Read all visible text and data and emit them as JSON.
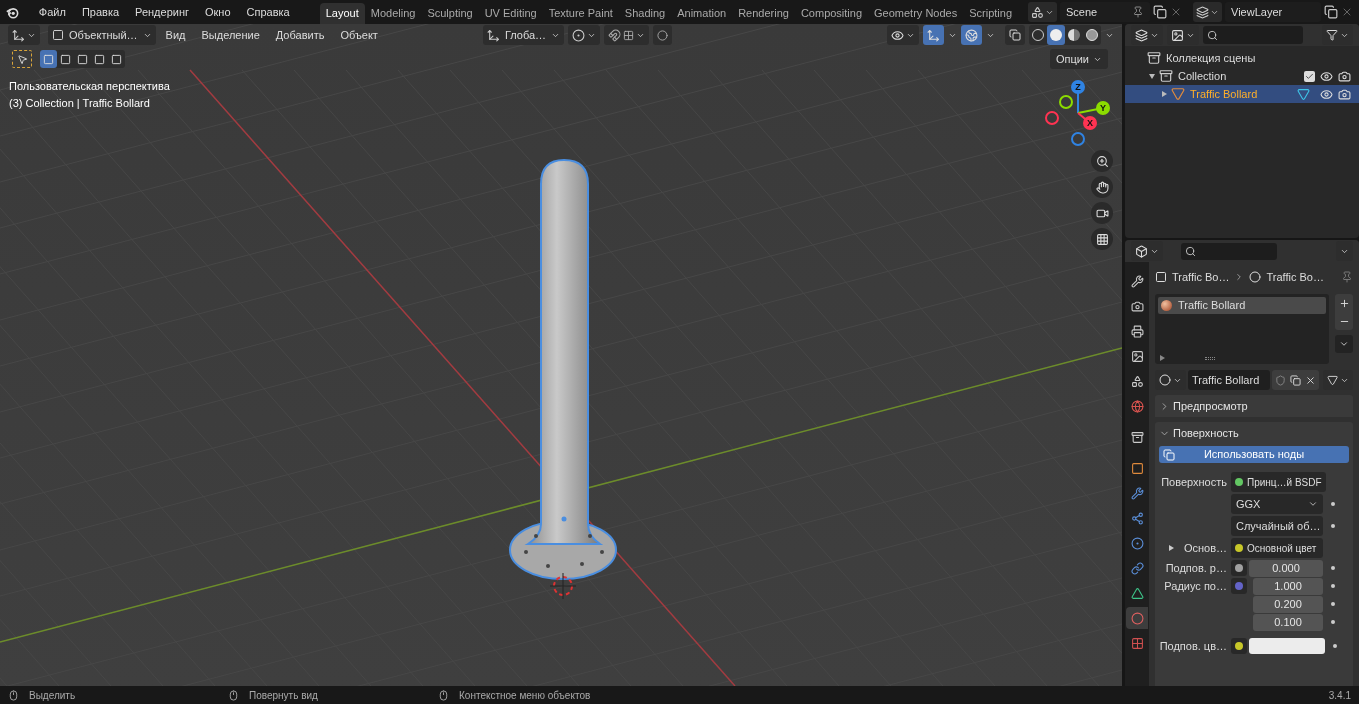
{
  "menu": [
    "Файл",
    "Правка",
    "Рендеринг",
    "Окно",
    "Справка"
  ],
  "workspaces": [
    {
      "label": "Layout",
      "selected": true
    },
    {
      "label": "Modeling",
      "selected": false
    },
    {
      "label": "Sculpting",
      "selected": false
    },
    {
      "label": "UV Editing",
      "selected": false
    },
    {
      "label": "Texture Paint",
      "selected": false
    },
    {
      "label": "Shading",
      "selected": false
    },
    {
      "label": "Animation",
      "selected": false
    },
    {
      "label": "Rendering",
      "selected": false
    },
    {
      "label": "Compositing",
      "selected": false
    },
    {
      "label": "Geometry Nodes",
      "selected": false
    },
    {
      "label": "Scripting",
      "selected": false
    }
  ],
  "scene": "Scene",
  "view_layer": "ViewLayer",
  "viewport": {
    "mode": "Объектный…",
    "menus": [
      "Вид",
      "Выделение",
      "Добавить",
      "Объект"
    ],
    "orientation": "Глоба…",
    "options": "Опции",
    "select_modes": [
      {
        "selected": true
      },
      {
        "selected": false
      },
      {
        "selected": false
      },
      {
        "selected": false
      },
      {
        "selected": false
      }
    ],
    "gizmos_on": true,
    "overlays_on": true,
    "shading": [
      {
        "kind": "wireframe",
        "selected": false
      },
      {
        "kind": "solid",
        "selected": true
      },
      {
        "kind": "material",
        "selected": false
      },
      {
        "kind": "rendered",
        "selected": false
      }
    ],
    "info": [
      "Пользовательская перспектива",
      "(3) Collection | Traffic Bollard"
    ],
    "axes": [
      {
        "label": "Z",
        "color": "#2f83e3"
      },
      {
        "label": "Y",
        "color": "#8bdc00"
      },
      {
        "label": "X",
        "color": "#ff3352"
      }
    ]
  },
  "outliner": {
    "items": [
      {
        "label": "Коллекция сцены",
        "selected": false,
        "children": [
          {
            "label": "Collection",
            "selected": false,
            "expanded": true,
            "checked": true,
            "children": [
              {
                "label": "Traffic Bollard",
                "selected": true,
                "expanded": false
              }
            ]
          }
        ]
      }
    ]
  },
  "properties": {
    "tabs": [
      {
        "kind": "tool",
        "selected": false
      },
      {
        "kind": "render",
        "selected": false
      },
      {
        "kind": "output",
        "selected": false
      },
      {
        "kind": "view_layer",
        "selected": false
      },
      {
        "kind": "scene",
        "selected": false
      },
      {
        "kind": "world",
        "selected": false
      },
      {
        "kind": "collection",
        "selected": false
      },
      {
        "kind": "object",
        "selected": false
      },
      {
        "kind": "modifiers",
        "selected": false
      },
      {
        "kind": "particles",
        "selected": false
      },
      {
        "kind": "physics",
        "selected": false
      },
      {
        "kind": "constraints",
        "selected": false
      },
      {
        "kind": "data",
        "selected": false
      },
      {
        "kind": "material",
        "selected": true
      },
      {
        "kind": "texture",
        "selected": false
      }
    ],
    "breadcrumb": [
      "Traffic Bo…",
      "Traffic Bo…"
    ],
    "slots": [
      {
        "name": "Traffic Bollard",
        "selected": true
      }
    ],
    "material": "Traffic Bollard",
    "panels": [
      {
        "title": "Предпросмотр",
        "expanded": false
      },
      {
        "title": "Поверхность",
        "expanded": true
      }
    ],
    "use_nodes": "Использовать ноды",
    "rows": [
      {
        "kind": "socket",
        "label": "Поверхность",
        "value": "Принц…й BSDF",
        "color": "#63c763"
      },
      {
        "kind": "dropdown",
        "value": "GGX"
      },
      {
        "kind": "dropdown",
        "value": "Случайный об…"
      },
      {
        "kind": "socket",
        "label": "Основ…",
        "value": "Основной цвет",
        "color": "#c7c729",
        "expandable": true
      },
      {
        "kind": "number",
        "label": "Подпов. р…",
        "values": [
          "0.000"
        ],
        "color": "#a1a1a1"
      },
      {
        "kind": "number",
        "label": "Радиус по…",
        "values": [
          "1.000",
          "0.200",
          "0.100"
        ],
        "color": "#6363c7"
      },
      {
        "kind": "swatch",
        "label": "Подпов. цв…",
        "color": "#c7c729"
      }
    ]
  },
  "status": {
    "items": [
      "Выделить",
      "Повернуть вид",
      "Контекстное меню объектов"
    ],
    "version": "3.4.1"
  }
}
